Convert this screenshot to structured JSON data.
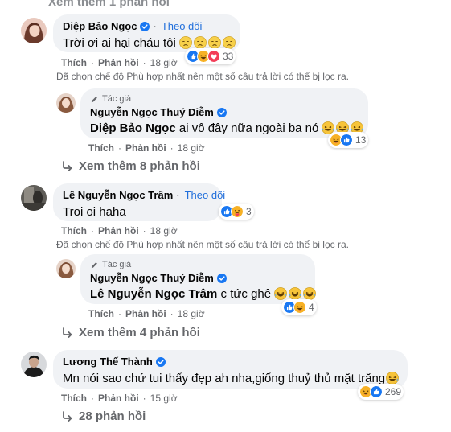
{
  "top_cut": {
    "label": "Xem thêm 1 phản hồi"
  },
  "common": {
    "like": "Thích",
    "reply": "Phản hồi",
    "follow": "Theo dõi",
    "dot": "·",
    "author_tag": "Tác giả",
    "filter_note": "Đã chọn chế độ Phù hợp nhất nên một số câu trả lời có thể bị lọc ra."
  },
  "comments": [
    {
      "author": "Diệp Bảo Ngọc",
      "text": "Trời ơi ai hại cháu tôi",
      "time": "18 giờ",
      "reaction_count": "33",
      "reply": {
        "author": "Nguyễn Ngọc Thuý Diễm",
        "mention": "Diệp Bảo Ngọc",
        "text": "ai vô đây nữa ngoài ba nó",
        "time": "18 giờ",
        "reaction_count": "13"
      },
      "more_replies": "Xem thêm 8 phản hồi"
    },
    {
      "author": "Lê Nguyễn Ngọc Trâm",
      "text": "Troi oi haha",
      "time": "18 giờ",
      "reaction_count": "3",
      "reply": {
        "author": "Nguyễn Ngọc Thuý Diễm",
        "mention": "Lê Nguyễn Ngọc Trâm",
        "text": "c tức ghê",
        "time": "18 giờ",
        "reaction_count": "4"
      },
      "more_replies": "Xem thêm 4 phản hồi"
    },
    {
      "author": "Lương Thế Thành",
      "text": "Mn nói sao chứ tui thấy đẹp ah nha,giống thuỷ thủ mặt trăng",
      "time": "15 giờ",
      "reaction_count": "269",
      "more_replies": "28 phản hồi"
    }
  ],
  "icons": {
    "like": "like-reaction-icon",
    "haha": "haha-reaction-icon",
    "love": "love-reaction-icon",
    "care": "care-reaction-icon",
    "sad": "sad-emoji-icon",
    "laugh": "laughing-emoji-icon",
    "verified": "verified-badge-icon",
    "reply_arrow": "reply-arrow-icon",
    "pencil": "pencil-icon"
  },
  "colors": {
    "bubble": "#f0f2f5",
    "link": "#216fdb",
    "secondary_text": "#65676b",
    "like_blue": "#1877f2",
    "love_red": "#f33e58",
    "haha_yellow": "#f7b125"
  }
}
